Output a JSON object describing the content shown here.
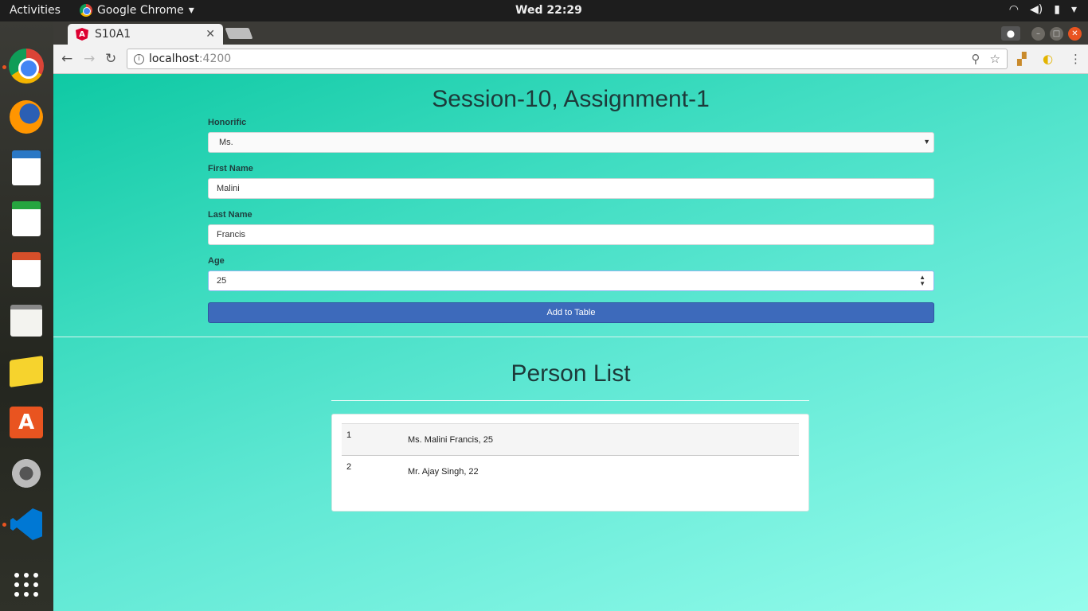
{
  "topbar": {
    "activities": "Activities",
    "app_name": "Google Chrome",
    "clock": "Wed 22:29"
  },
  "dock": {
    "items": [
      "chrome",
      "firefox",
      "writer",
      "calc",
      "impress",
      "text-editor",
      "notes",
      "software",
      "settings",
      "vscode",
      "apps"
    ]
  },
  "browser": {
    "tab_title": "S10A1",
    "url_host": "localhost",
    "url_port": ":4200"
  },
  "page": {
    "title": "Session-10, Assignment-1",
    "form": {
      "honorific_label": "Honorific",
      "honorific_value": "Ms.",
      "first_name_label": "First Name",
      "first_name_value": "Malini",
      "last_name_label": "Last Name",
      "last_name_value": "Francis",
      "age_label": "Age",
      "age_value": "25",
      "add_button": "Add to Table"
    },
    "list_title": "Person List",
    "persons": [
      {
        "index": "1",
        "text": "Ms. Malini Francis, 25"
      },
      {
        "index": "2",
        "text": "Mr. Ajay Singh, 22"
      }
    ]
  },
  "colors": {
    "accent_button": "#3d6abb",
    "page_gradient_start": "#0fc9a4",
    "page_gradient_end": "#95fcec",
    "ubuntu_orange": "#e95420"
  }
}
